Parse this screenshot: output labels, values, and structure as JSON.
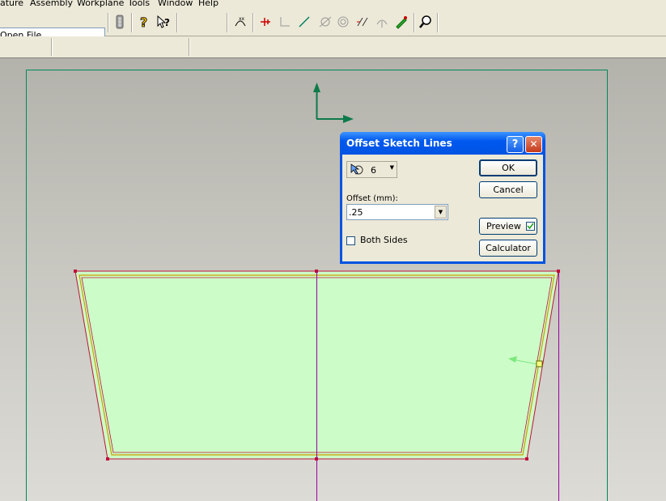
{
  "menubar": {
    "items": [
      "ature",
      "Assembly",
      "Workplane",
      "Tools",
      "Window",
      "Help"
    ]
  },
  "toolbar": {
    "open_file_label": "Open File",
    "combo_value": ""
  },
  "dialog": {
    "title": "Offset Sketch Lines",
    "help_label": "?",
    "close_label": "✕",
    "selector_value": "6",
    "offset_label": "Offset (mm):",
    "offset_value": ".25",
    "both_sides_label": "Both Sides",
    "both_sides_checked": false,
    "ok_label": "OK",
    "cancel_label": "Cancel",
    "preview_label": "Preview",
    "preview_checked": true,
    "calculator_label": "Calculator"
  },
  "colors": {
    "region_fill": "#ccfcc8",
    "sketch_line": "#c0103a",
    "offset_line": "#c8a000",
    "axis_green": "#0d7a4a",
    "workplane_border": "#008a5a",
    "vertical_line": "#9a00a0"
  }
}
